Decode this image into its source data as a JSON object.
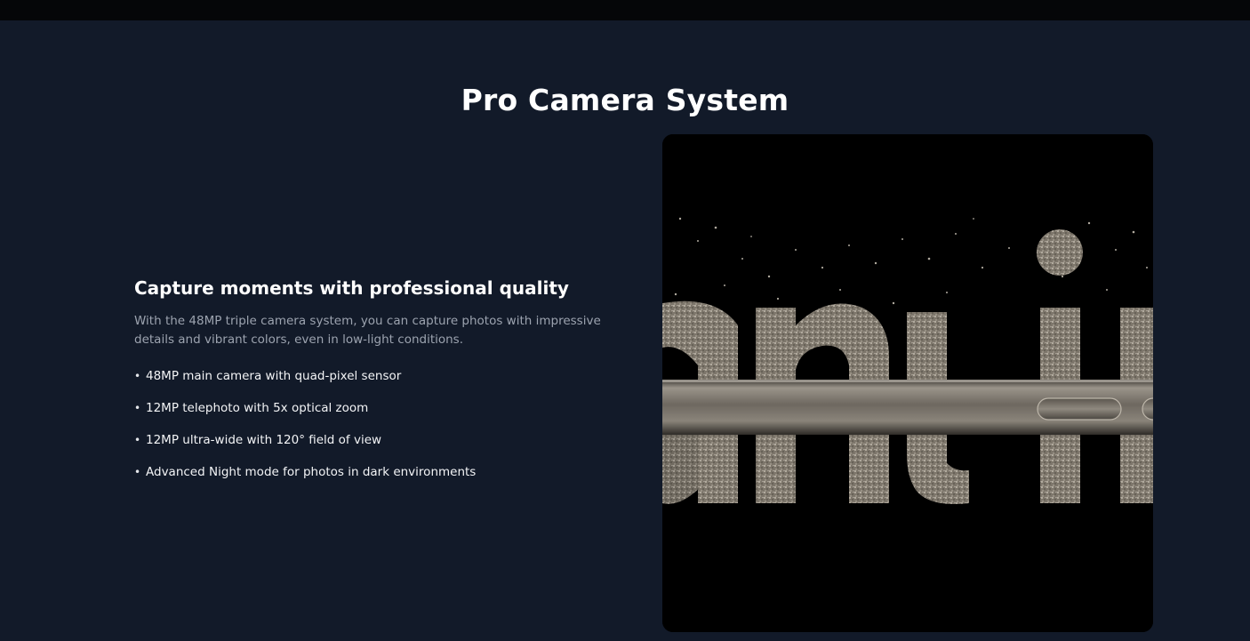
{
  "section": {
    "title": "Pro Camera System"
  },
  "feature": {
    "subtitle": "Capture moments with professional quality",
    "description": "With the 48MP triple camera system, you can capture photos with impressive details and vibrant colors, even in low-light conditions.",
    "bullets": [
      "48MP main camera with quad-pixel sensor",
      "12MP telephoto with 5x optical zoom",
      "12MP ultra-wide with 120° field of view",
      "Advanced Night mode for photos in dark environments"
    ]
  },
  "image": {
    "alt_icon": "titanium-frame-photo",
    "colors": {
      "background": "#000000",
      "particles": "#b9b2a6",
      "band": "#8c857a"
    }
  },
  "colors": {
    "page_bg": "#121a29",
    "topbar_bg": "#050608",
    "muted_text": "#9ca3af"
  }
}
